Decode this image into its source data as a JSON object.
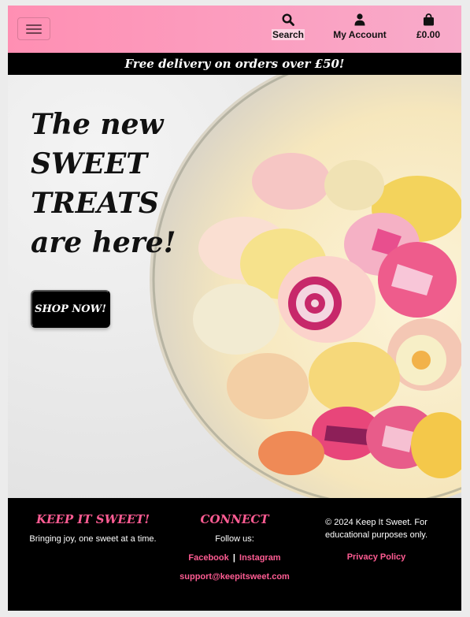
{
  "nav": {
    "menu_toggle": "menu-toggle",
    "search_label": "Search",
    "account_label": "My Account",
    "bag_total": "£0.00"
  },
  "promo": {
    "text": "Free delivery on orders over £50!"
  },
  "hero": {
    "title": "The new SWEET TREATS are here!",
    "cta": "SHOP NOW!"
  },
  "footer": {
    "brand": "KEEP IT SWEET!",
    "tagline": "Bringing joy, one sweet at a time.",
    "connect_heading": "CONNECT",
    "follow_text": "Follow us:",
    "facebook": "Facebook",
    "separator": "|",
    "instagram": "Instagram",
    "email": "support@keepitsweet.com",
    "copyright": "© 2024 Keep It Sweet. For educational purposes only.",
    "privacy": "Privacy Policy"
  },
  "colors": {
    "nav_gradient_start": "#ff8fb3",
    "nav_gradient_end": "#f8abca",
    "accent_pink": "#ff5c93",
    "bar_black": "#000000"
  },
  "icons": {
    "menu": "hamburger-icon",
    "search": "search-icon",
    "account": "user-icon",
    "bag": "shopping-bag-icon"
  }
}
